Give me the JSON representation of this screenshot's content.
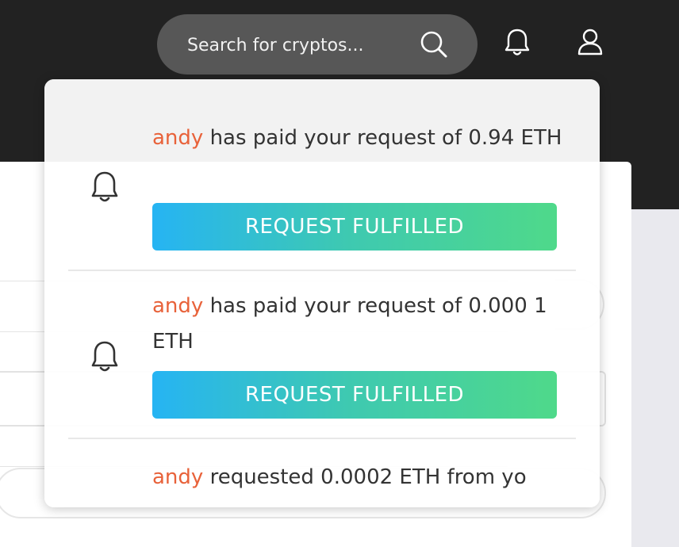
{
  "header": {
    "search": {
      "placeholder": "Search for cryptos..."
    },
    "search_button_icon": "search-icon",
    "notifications_icon": "bell-icon",
    "profile_icon": "user-icon"
  },
  "notifications": [
    {
      "user": "andy",
      "message": " has paid your request of 0.94 ETH",
      "status": "REQUEST FULFILLED",
      "icon": "bell-icon"
    },
    {
      "user": "andy",
      "message": " has paid your request of 0.000 1 ETH",
      "status": "REQUEST FULFILLED",
      "icon": "bell-icon"
    },
    {
      "user": "andy",
      "message": " requested 0.0002 ETH from yo"
    }
  ],
  "colors": {
    "header_bg": "#222222",
    "search_bg": "#575757",
    "username": "#e8623a",
    "fulfilled_gradient_start": "#26b4f3",
    "fulfilled_gradient_end": "#4fd98a"
  }
}
